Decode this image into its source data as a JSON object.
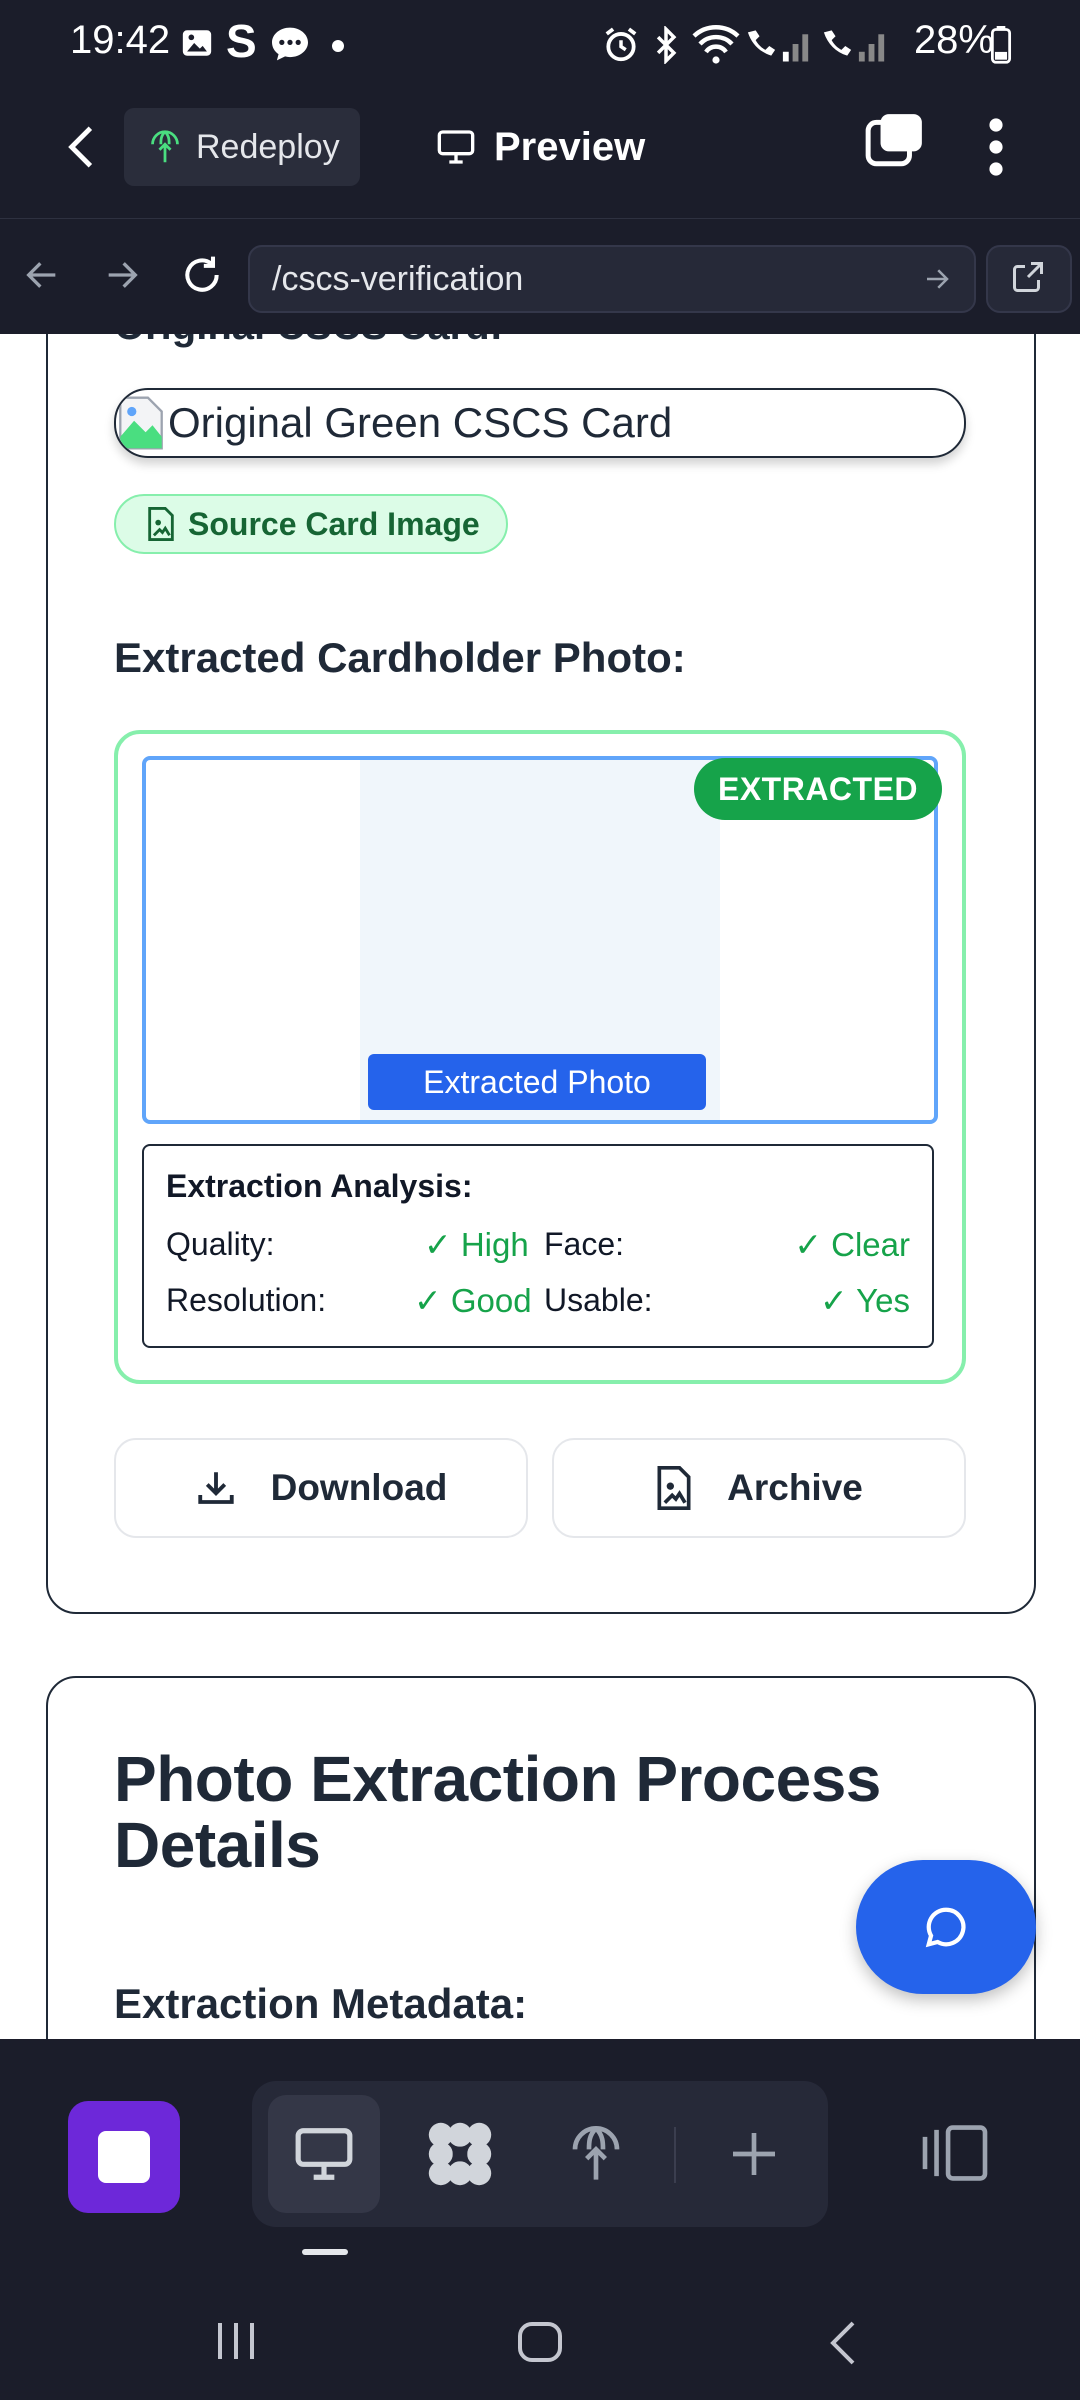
{
  "status_bar": {
    "time": "19:42",
    "battery": "28%"
  },
  "app_bar": {
    "redeploy_label": "Redeploy",
    "preview_label": "Preview"
  },
  "url_bar": {
    "path": "/cscs-verification"
  },
  "card1": {
    "cut_title": "Original CSCS Card:",
    "image_alt": "Original Green CSCS Card",
    "source_pill": "Source Card Image",
    "extracted_heading": "Extracted Cardholder Photo:",
    "extracted_badge": "EXTRACTED",
    "photo_label": "Extracted Photo",
    "analysis": {
      "title": "Extraction Analysis:",
      "quality_label": "Quality:",
      "quality_value": "✓ High",
      "face_label": "Face:",
      "face_value": "✓ Clear",
      "resolution_label": "Resolution:",
      "resolution_value": "✓ Good",
      "usable_label": "Usable:",
      "usable_value": "✓ Yes"
    },
    "download_label": "Download",
    "archive_label": "Archive"
  },
  "card2": {
    "heading": "Photo Extraction Process Details",
    "metadata_heading": "Extraction Metadata:"
  },
  "colors": {
    "accent": "#2563eb",
    "success": "#16a34a",
    "brand_purple": "#6d28d9",
    "chrome": "#1b1d2a"
  }
}
